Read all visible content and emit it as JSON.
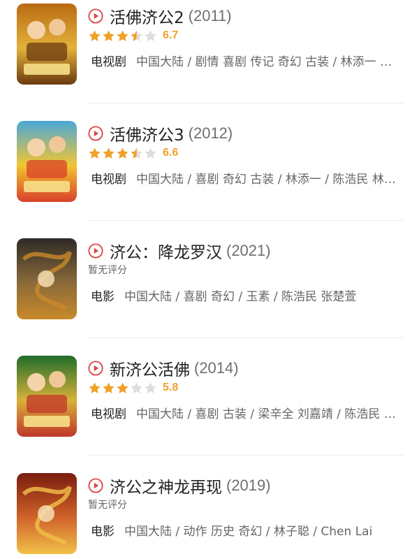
{
  "colors": {
    "accent": "#d94545",
    "star_filled": "#f0a12b",
    "star_empty": "#dddddd",
    "title": "#222222",
    "meta": "#666666"
  },
  "items": [
    {
      "title": "活佛济公2",
      "year": "(2011)",
      "rating": 3.5,
      "score": "6.7",
      "no_rating_text": "",
      "type": "电视剧",
      "info": "中国大陆 / 剧情 喜剧 传记 奇幻 古装 / 林添一 …",
      "poster_colors": [
        "#b86a12",
        "#e3b23a",
        "#6b3a10"
      ],
      "poster_icon": "monk-poster-icon"
    },
    {
      "title": "活佛济公3",
      "year": "(2012)",
      "rating": 3.5,
      "score": "6.6",
      "no_rating_text": "",
      "type": "电视剧",
      "info": "中国大陆 / 喜剧 奇幻 古装 / 林添一 / 陈浩民 林…",
      "poster_colors": [
        "#4aa8d8",
        "#f2c531",
        "#d9402a"
      ],
      "poster_icon": "monk-poster-icon"
    },
    {
      "title": "济公：降龙罗汉",
      "year": "(2021)",
      "rating": null,
      "score": "",
      "no_rating_text": "暂无评分",
      "type": "电影",
      "info": "中国大陆 / 喜剧 奇幻 / 玉素 / 陈浩民 张楚萱",
      "poster_colors": [
        "#2d2a26",
        "#8a6a3a",
        "#c98a2a"
      ],
      "poster_icon": "dragon-poster-icon"
    },
    {
      "title": "新济公活佛",
      "year": "(2014)",
      "rating": 3,
      "score": "5.8",
      "no_rating_text": "",
      "type": "电视剧",
      "info": "中国大陆 / 喜剧 古装 / 梁辛全 刘嘉靖 / 陈浩民 …",
      "poster_colors": [
        "#1f6d2a",
        "#d8b13a",
        "#c0362a"
      ],
      "poster_icon": "monk-poster-icon"
    },
    {
      "title": "济公之神龙再现",
      "year": "(2019)",
      "rating": null,
      "score": "",
      "no_rating_text": "暂无评分",
      "type": "电影",
      "info": "中国大陆 / 动作 历史 奇幻 / 林子聪 / Chen Lai",
      "poster_colors": [
        "#7a1c0e",
        "#d0632a",
        "#f2c14a"
      ],
      "poster_icon": "dragon-poster-icon"
    }
  ]
}
